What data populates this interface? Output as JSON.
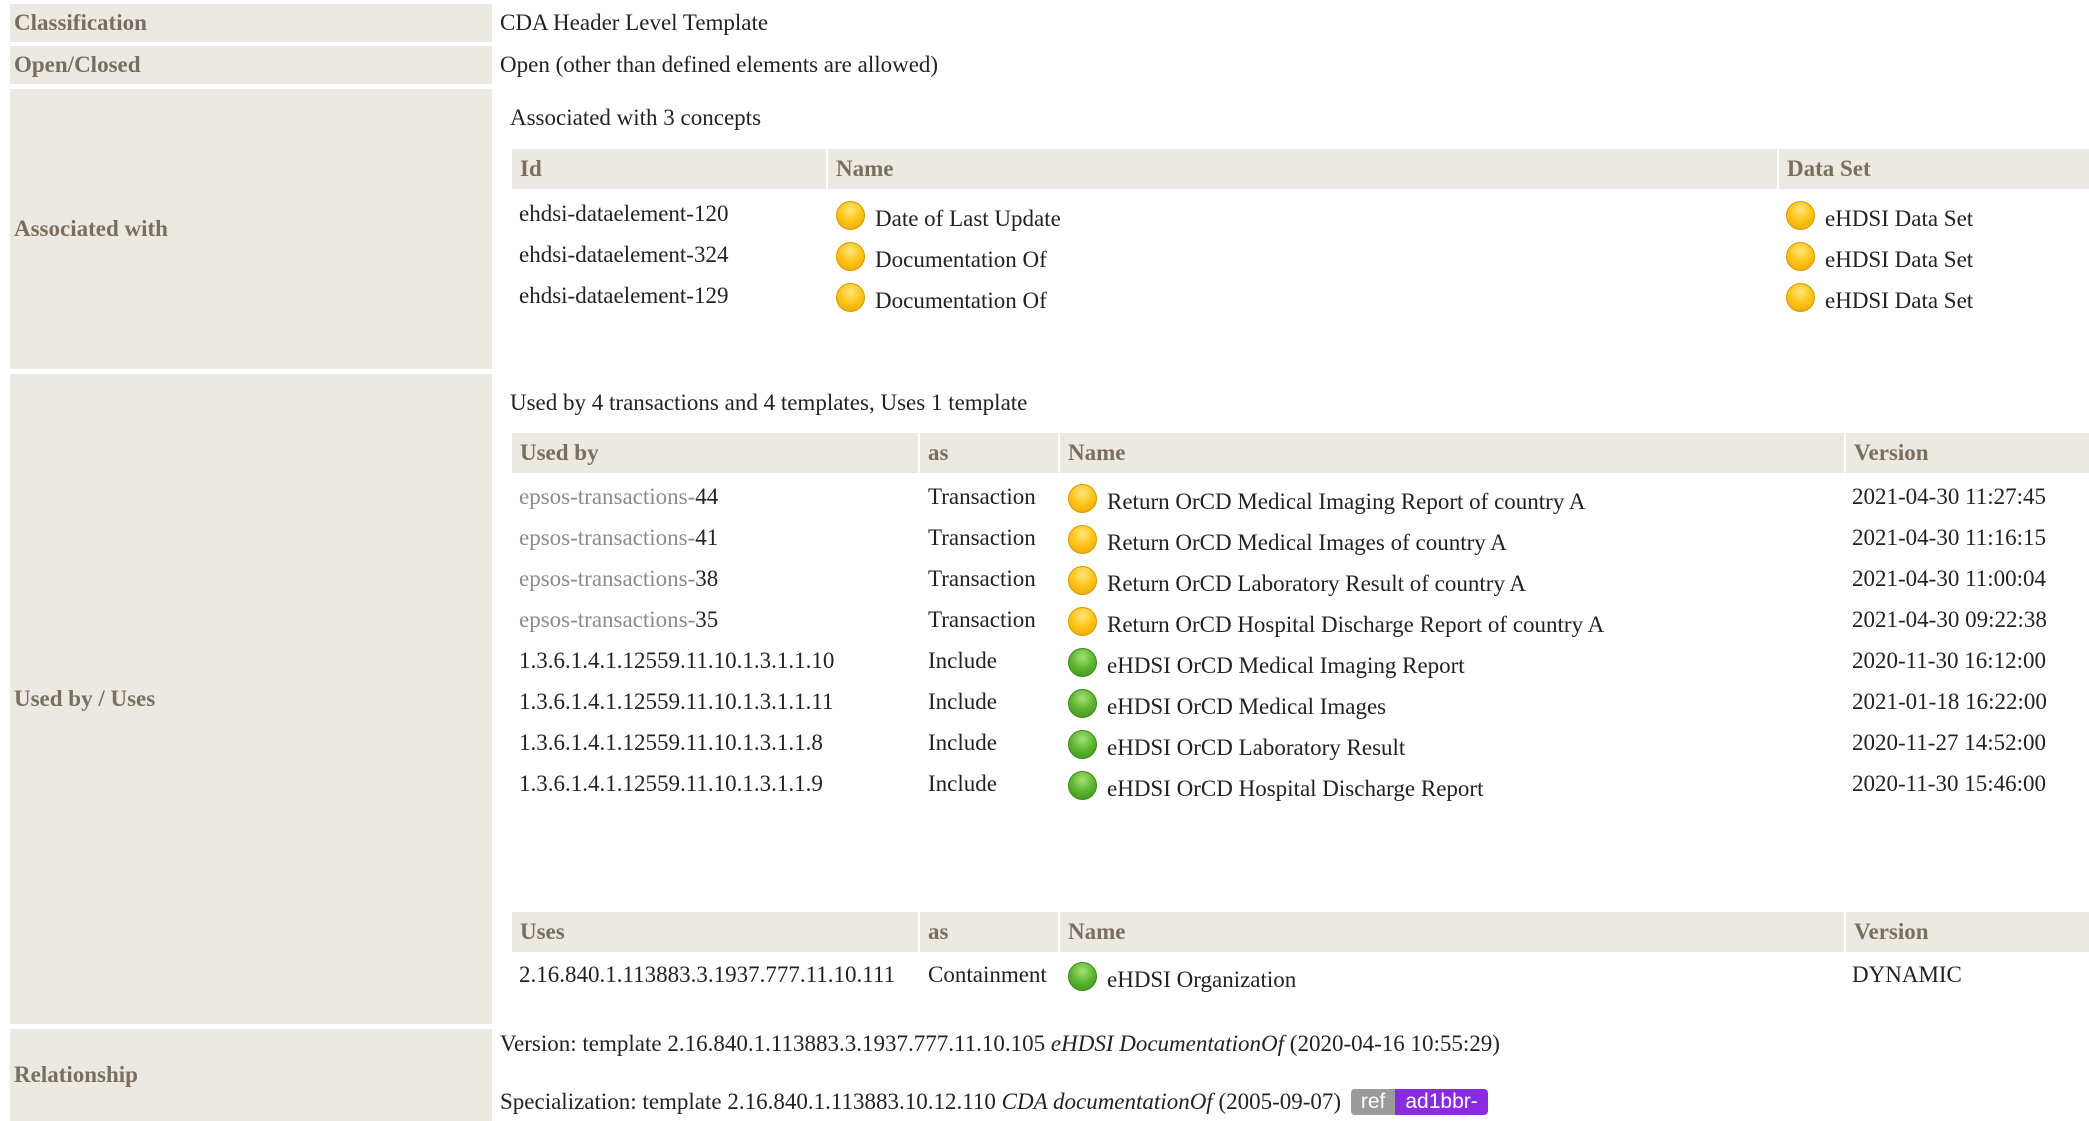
{
  "classification": {
    "label": "Classification",
    "value": "CDA Header Level Template"
  },
  "open_closed": {
    "label": "Open/Closed",
    "value": "Open (other than defined elements are allowed)"
  },
  "associated_with": {
    "label": "Associated with",
    "caption": "Associated with 3 concepts",
    "headers": {
      "id": "Id",
      "name": "Name",
      "dataset": "Data Set"
    },
    "rows": [
      {
        "id": "ehdsi-dataelement-120",
        "name": "Date of Last Update",
        "dataset": "eHDSI Data Set",
        "status": "yellow"
      },
      {
        "id": "ehdsi-dataelement-324",
        "name": "Documentation Of",
        "dataset": "eHDSI Data Set",
        "status": "yellow"
      },
      {
        "id": "ehdsi-dataelement-129",
        "name": "Documentation Of",
        "dataset": "eHDSI Data Set",
        "status": "yellow"
      }
    ]
  },
  "used_by": {
    "label": "Used by / Uses",
    "caption": "Used by 4 transactions and 4 templates, Uses 1 template",
    "headers": {
      "used_by": "Used by",
      "as": "as",
      "name": "Name",
      "version": "Version"
    },
    "rows": [
      {
        "prefix": "epsos-transactions-",
        "num": "44",
        "as": "Transaction",
        "name": "Return OrCD Medical Imaging Report of country A",
        "version": "2021-04-30 11:27:45",
        "status": "yellow"
      },
      {
        "prefix": "epsos-transactions-",
        "num": "41",
        "as": "Transaction",
        "name": "Return OrCD Medical Images of country A",
        "version": "2021-04-30 11:16:15",
        "status": "yellow"
      },
      {
        "prefix": "epsos-transactions-",
        "num": "38",
        "as": "Transaction",
        "name": "Return OrCD Laboratory Result of country A",
        "version": "2021-04-30 11:00:04",
        "status": "yellow"
      },
      {
        "prefix": "epsos-transactions-",
        "num": "35",
        "as": "Transaction",
        "name": "Return OrCD Hospital Discharge Report of country A",
        "version": "2021-04-30 09:22:38",
        "status": "yellow"
      },
      {
        "prefix": "",
        "num": "1.3.6.1.4.1.12559.11.10.1.3.1.1.10",
        "as": "Include",
        "name": "eHDSI OrCD Medical Imaging Report",
        "version": "2020-11-30 16:12:00",
        "status": "green"
      },
      {
        "prefix": "",
        "num": "1.3.6.1.4.1.12559.11.10.1.3.1.1.11",
        "as": "Include",
        "name": "eHDSI OrCD Medical Images",
        "version": "2021-01-18 16:22:00",
        "status": "green"
      },
      {
        "prefix": "",
        "num": "1.3.6.1.4.1.12559.11.10.1.3.1.1.8",
        "as": "Include",
        "name": "eHDSI OrCD Laboratory Result",
        "version": "2020-11-27 14:52:00",
        "status": "green"
      },
      {
        "prefix": "",
        "num": "1.3.6.1.4.1.12559.11.10.1.3.1.1.9",
        "as": "Include",
        "name": "eHDSI OrCD Hospital Discharge Report",
        "version": "2020-11-30 15:46:00",
        "status": "green"
      }
    ],
    "uses_headers": {
      "uses": "Uses",
      "as": "as",
      "name": "Name",
      "version": "Version"
    },
    "uses_rows": [
      {
        "id": "2.16.840.1.113883.3.1937.777.11.10.111",
        "as": "Containment",
        "name": "eHDSI Organization",
        "version": "DYNAMIC",
        "status": "green"
      }
    ]
  },
  "relationship": {
    "label": "Relationship",
    "version_prefix": "Version: template 2.16.840.1.113883.3.1937.777.11.10.105 ",
    "version_name": "eHDSI DocumentationOf",
    "version_date": " (2020-04-16 10:55:29)",
    "spec_prefix": "Specialization: template 2.16.840.1.113883.10.12.110 ",
    "spec_name": "CDA documentationOf",
    "spec_date": " (2005-09-07)",
    "badge_ref": "ref",
    "badge_id": "ad1bbr-"
  },
  "colors": {
    "label_bg": "#ece9e2",
    "label_text": "#7a6f5f",
    "muted_link": "#8b8b8b",
    "badge_purple": "#8a2be2",
    "status_yellow": "#ffc61a",
    "status_green": "#5cb52e"
  }
}
